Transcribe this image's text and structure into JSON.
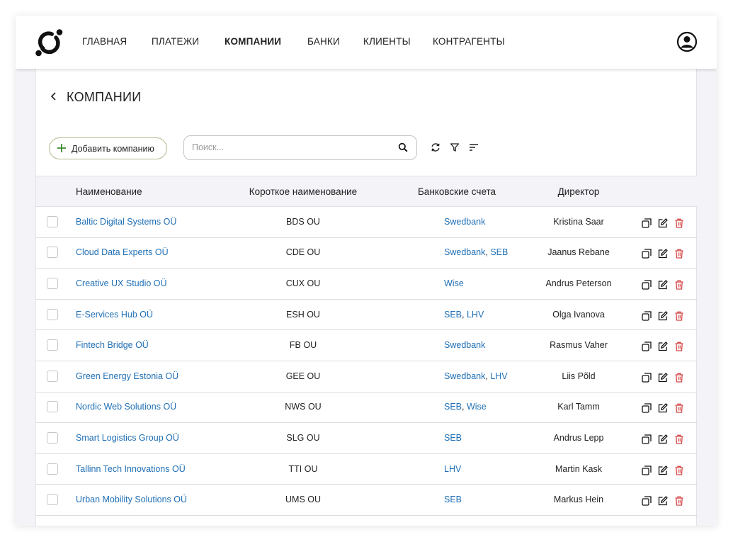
{
  "nav": {
    "items": [
      {
        "label": "ГЛАВНАЯ",
        "active": false
      },
      {
        "label": "ПЛАТЕЖИ",
        "active": false
      },
      {
        "label": "КОМПАНИИ",
        "active": true
      },
      {
        "label": "БАНКИ",
        "active": false
      },
      {
        "label": "КЛИЕНТЫ",
        "active": false
      },
      {
        "label": "КОНТРАГЕНТЫ",
        "active": false
      }
    ]
  },
  "page": {
    "title": "КОМПАНИИ"
  },
  "toolbar": {
    "add_label": "Добавить компанию",
    "search_placeholder": "Поиск...",
    "search_value": ""
  },
  "table": {
    "columns": [
      "Наименование",
      "Короткое наименование",
      "Банковские счета",
      "Директор"
    ],
    "rows": [
      {
        "name": "Baltic Digital Systems OÜ",
        "short": "BDS OU",
        "banks": [
          "Swedbank"
        ],
        "director": "Kristina Saar"
      },
      {
        "name": "Cloud Data Experts OÜ",
        "short": "CDE OU",
        "banks": [
          "Swedbank",
          "SEB"
        ],
        "director": "Jaanus Rebane"
      },
      {
        "name": "Creative UX Studio OÜ",
        "short": "CUX OU",
        "banks": [
          "Wise"
        ],
        "director": "Andrus Peterson"
      },
      {
        "name": "E-Services Hub OÜ",
        "short": "ESH OU",
        "banks": [
          "SEB",
          "LHV"
        ],
        "director": "Olga Ivanova"
      },
      {
        "name": "Fintech Bridge OÜ",
        "short": "FB OU",
        "banks": [
          "Swedbank"
        ],
        "director": "Rasmus Vaher"
      },
      {
        "name": "Green Energy Estonia OÜ",
        "short": "GEE OU",
        "banks": [
          "Swedbank",
          "LHV"
        ],
        "director": "Liis Põld"
      },
      {
        "name": "Nordic Web Solutions OÜ",
        "short": "NWS OU",
        "banks": [
          "SEB",
          "Wise"
        ],
        "director": "Karl Tamm"
      },
      {
        "name": "Smart Logistics Group OÜ",
        "short": "SLG OU",
        "banks": [
          "SEB"
        ],
        "director": "Andrus Lepp"
      },
      {
        "name": "Tallinn Tech Innovations OÜ",
        "short": "TTI OU",
        "banks": [
          "LHV"
        ],
        "director": "Martin Kask"
      },
      {
        "name": "Urban Mobility Solutions OÜ",
        "short": "UMS OU",
        "banks": [
          "SEB"
        ],
        "director": "Markus Hein"
      }
    ]
  },
  "colors": {
    "link": "#1f6fb5",
    "delete": "#d64545",
    "add_border": "#b5b98f",
    "plus": "#3d8b2f"
  },
  "icons": [
    "logo-icon",
    "user-avatar-icon",
    "back-arrow-icon",
    "plus-icon",
    "search-icon",
    "refresh-icon",
    "filter-icon",
    "sort-icon",
    "copy-icon",
    "edit-icon",
    "delete-icon"
  ]
}
